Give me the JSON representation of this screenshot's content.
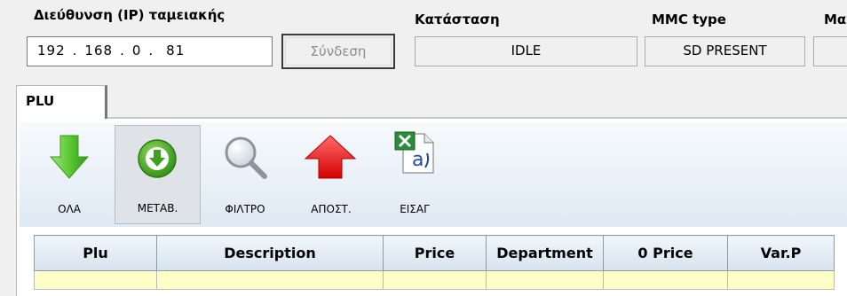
{
  "header": {
    "ip_label": "Διεύθυνση (IP) ταμειακής",
    "status_label": "Κατάσταση",
    "mmc_label": "MMC type",
    "extra_label": "Μα",
    "ip_octets": [
      "192",
      "168",
      "0",
      "81"
    ],
    "ip_separator": ".",
    "connect_label": "Σύνδεση",
    "status_value": "IDLE",
    "mmc_value": "SD PRESENT",
    "extra_value": ""
  },
  "tabs": [
    {
      "label": "PLU"
    }
  ],
  "toolbar": {
    "items": [
      {
        "label": "ΟΛΑ",
        "icon": "arrow-down-green-icon"
      },
      {
        "label": "ΜΕΤΑΒ.",
        "icon": "download-circle-icon"
      },
      {
        "label": "ΦΙΛΤΡΟ",
        "icon": "magnifier-icon"
      },
      {
        "label": "ΑΠΟΣΤ.",
        "icon": "arrow-up-red-icon"
      },
      {
        "label": "ΕΙΣΑΓ",
        "icon": "excel-file-icon"
      }
    ]
  },
  "table": {
    "columns": [
      "Plu",
      "Description",
      "Price",
      "Department",
      "0 Price",
      "Var.P"
    ]
  },
  "colors": {
    "row_highlight": "#ffffc8",
    "header_grad_top": "#f0f6fb",
    "header_grad_bottom": "#d7e3ee",
    "arrow_green": "#5cc934",
    "arrow_red": "#ff1a1a"
  }
}
